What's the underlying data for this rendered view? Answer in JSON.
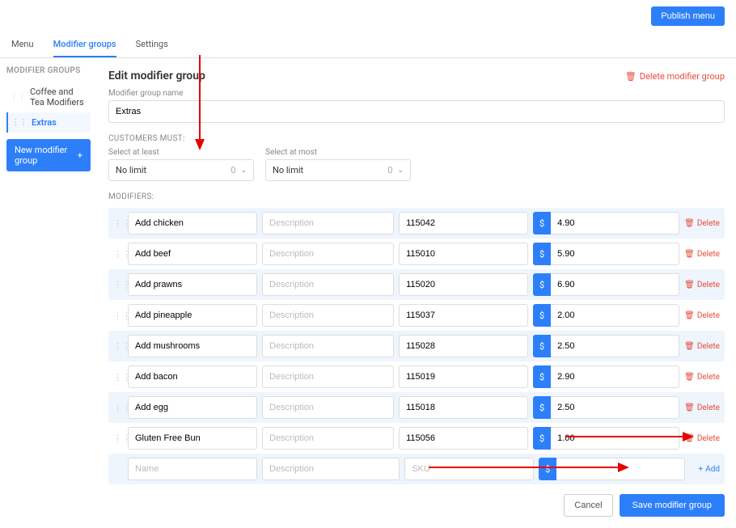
{
  "header": {
    "publish_label": "Publish menu"
  },
  "tabs": {
    "menu": "Menu",
    "modgroups": "Modifier groups",
    "settings": "Settings"
  },
  "sidebar": {
    "header": "MODIFIER GROUPS",
    "items": [
      "Coffee and Tea Modifiers",
      "Extras"
    ],
    "new_label": "New modifier group"
  },
  "panel": {
    "title": "Edit modifier group",
    "delete_label": "Delete modifier group",
    "name_label": "Modifier group name",
    "name_value": "Extras",
    "customers_must": "CUSTOMERS MUST:",
    "at_least_label": "Select at least",
    "at_most_label": "Select at most",
    "no_limit": "No limit",
    "zero": "0",
    "modifiers_label": "MODIFIERS:",
    "desc_placeholder": "Description",
    "name_placeholder": "Name",
    "sku_placeholder": "SKU",
    "currency": "$",
    "delete_row": "Delete",
    "add_row": "Add",
    "cancel": "Cancel",
    "save": "Save modifier group"
  },
  "modifiers": [
    {
      "name": "Add chicken",
      "sku": "115042",
      "price": "4.90"
    },
    {
      "name": "Add beef",
      "sku": "115010",
      "price": "5.90"
    },
    {
      "name": "Add prawns",
      "sku": "115020",
      "price": "6.90"
    },
    {
      "name": "Add pineapple",
      "sku": "115037",
      "price": "2.00"
    },
    {
      "name": "Add mushrooms",
      "sku": "115028",
      "price": "2.50"
    },
    {
      "name": "Add bacon",
      "sku": "115019",
      "price": "2.90"
    },
    {
      "name": "Add egg",
      "sku": "115018",
      "price": "2.50"
    },
    {
      "name": "Gluten Free Bun",
      "sku": "115056",
      "price": "1.00"
    }
  ]
}
